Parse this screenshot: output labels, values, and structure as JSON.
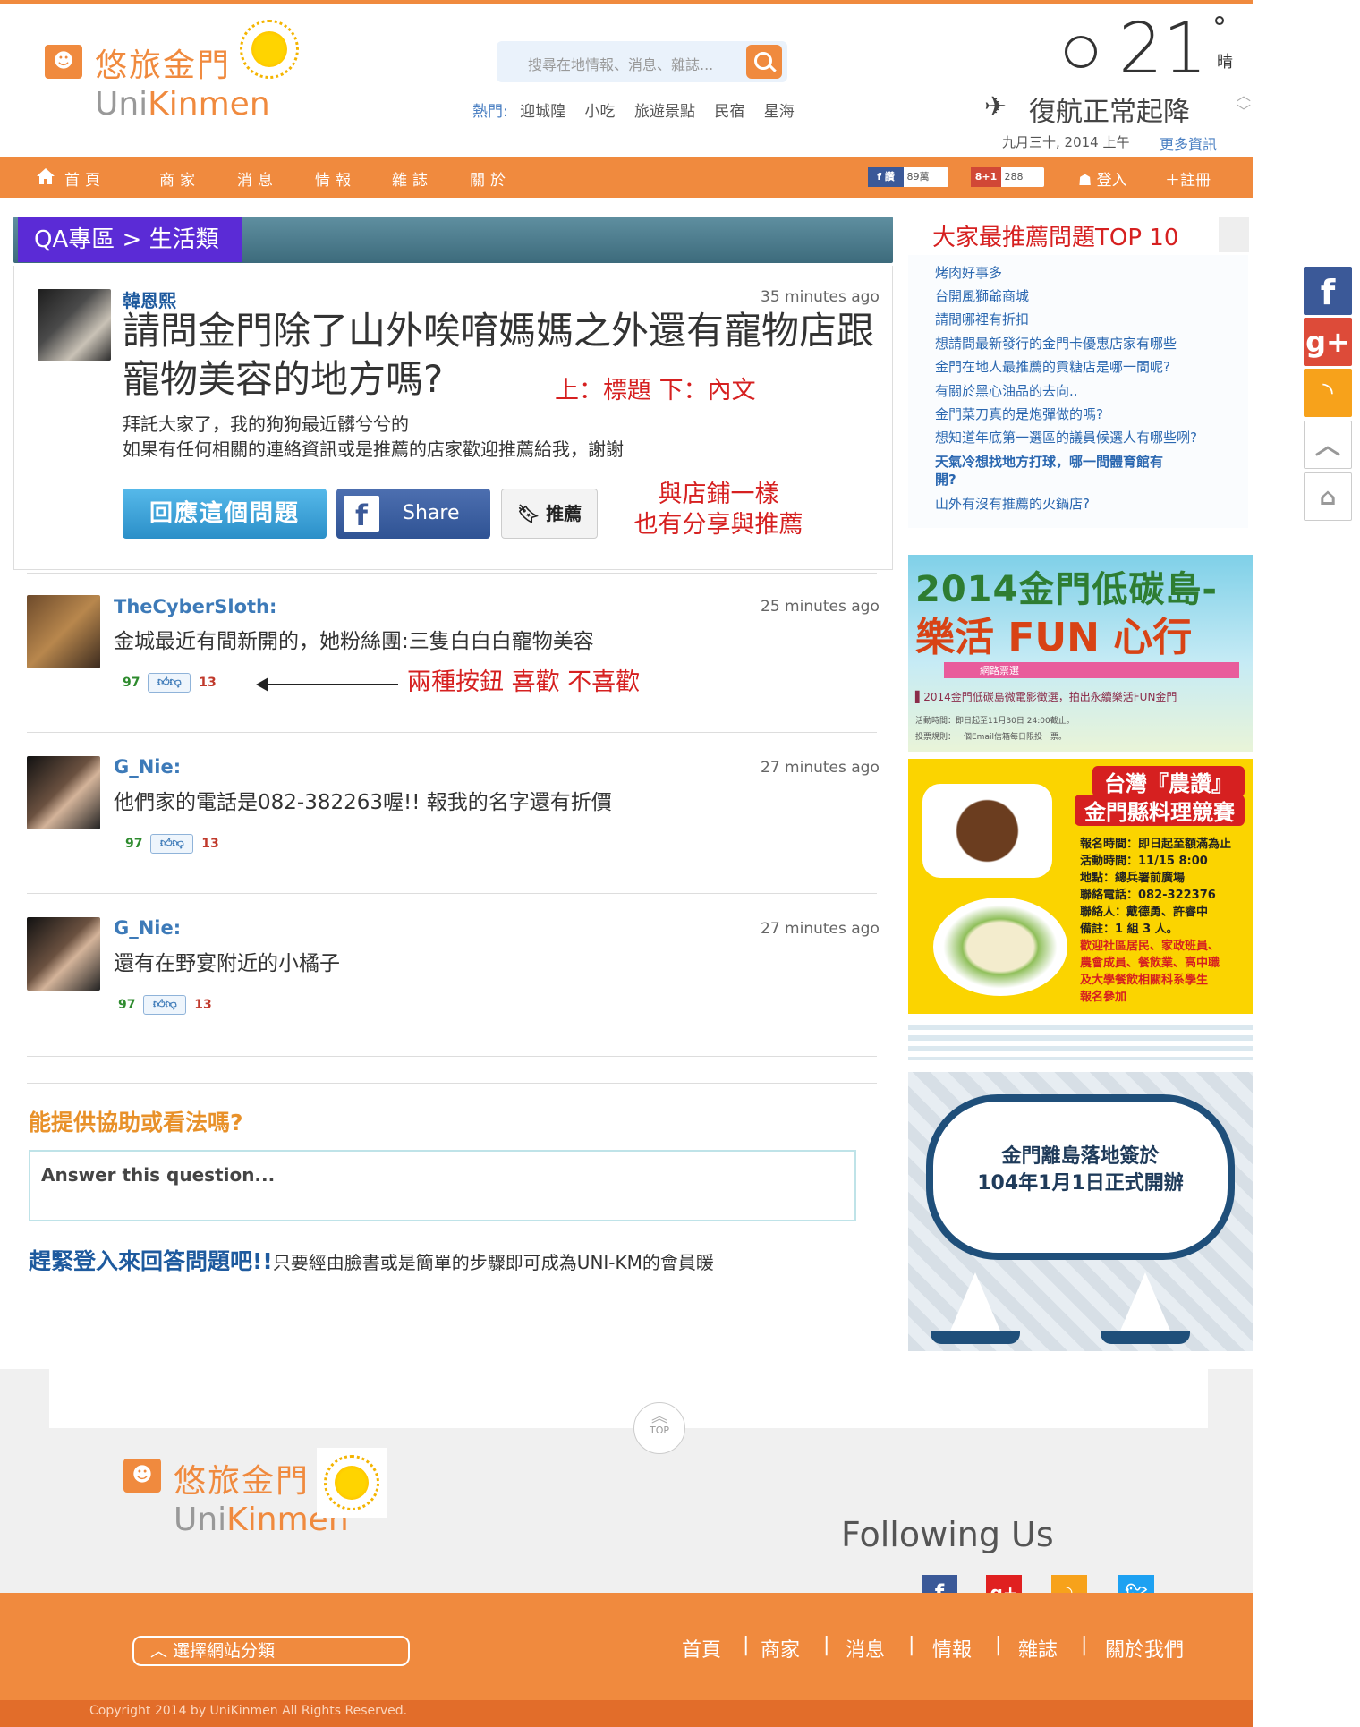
{
  "header": {
    "logo_cn": "悠旅金門",
    "logo_en_prefix": "Uni",
    "logo_en_suffix": "Kinmen",
    "search_placeholder": "搜尋在地情報、消息、雜誌...",
    "hot_label": "熱門:",
    "hot_tags": [
      "迎城隍",
      "小吃",
      "旅遊景點",
      "民宿",
      "星海"
    ]
  },
  "weather": {
    "temperature": "21",
    "degree": "°",
    "condition": "晴",
    "flight_status": "復航正常起降",
    "date": "九月三十, 2014  上午",
    "more_link": "更多資訊"
  },
  "nav": {
    "items": [
      "首頁",
      "商家",
      "消息",
      "情報",
      "雜誌",
      "關於"
    ],
    "fb_count": "89萬",
    "gplus_label": "8+1",
    "gplus_count": "288",
    "login": "登入",
    "register": "註冊"
  },
  "breadcrumb": "QA專區 > 生活類",
  "question": {
    "user": "韓恩熙",
    "time": "35 minutes ago",
    "title": "請問金門除了山外唉唷媽媽之外還有寵物店跟寵物美容的地方嗎?",
    "body_line1": "拜託大家了，我的狗狗最近髒兮兮的",
    "body_line2": "如果有任何相關的連絡資訊或是推薦的店家歡迎推薦給我，謝謝",
    "reply_button": "回應這個問題",
    "share_button": "Share",
    "recommend_button": "推薦"
  },
  "annotations": {
    "title_note": "上：標題 下：內文",
    "share_note_1": "與店鋪一樣",
    "share_note_2": "也有分享與推薦",
    "vote_note": "兩種按鈕 喜歡 不喜歡"
  },
  "answers": [
    {
      "user": "TheCyberSloth:",
      "time": "25 minutes ago",
      "text": "金城最近有間新開的，她粉絲團:三隻白白白寵物美容",
      "likes": "97",
      "dislikes": "13"
    },
    {
      "user": "G_Nie:",
      "time": "27 minutes ago",
      "text": "他們家的電話是082-382263喔!! 報我的名字還有折價",
      "likes": "97",
      "dislikes": "13"
    },
    {
      "user": "G_Nie:",
      "time": "27 minutes ago",
      "text": "還有在野宴附近的小橘子",
      "likes": "97",
      "dislikes": "13"
    }
  ],
  "help": {
    "title": "能提供協助或看法嗎?",
    "answer_placeholder": "Answer this question...",
    "cta_bold": "趕緊登入來回答問題吧!!",
    "cta_text": "只要經由臉書或是簡單的步驟即可成為UNI-KM的會員䁔"
  },
  "sidebar": {
    "title": "大家最推薦問題TOP 10",
    "items": [
      "烤肉好事多",
      "台開風獅爺商城",
      "請問哪裡有折扣",
      "想請問最新發行的金門卡優惠店家有哪些",
      "金門在地人最推薦的貢糖店是哪一間呢?",
      "有關於黑心油品的去向..",
      "金門菜刀真的是炮彈做的嗎?",
      "想知道年底第一選區的議員候選人有哪些咧?",
      "天氣冷想找地方打球，哪一間體育館有",
      "開?",
      "山外有沒有推薦的火鍋店?"
    ]
  },
  "ads": {
    "ad1_title1": "2014金門低碳島-",
    "ad1_title2": "樂活 FUN 心行",
    "ad1_bar": "網路票選",
    "ad1_line1": "▌2014金門低碳島微電影徵選，拍出永續樂活FUN金門",
    "ad1_line2": "活動時間：即日起至11月30日 24:00截止。",
    "ad1_line3": "投票規則：一個Email信箱每日限投一票。",
    "ad2_title1": "台灣『農讚』",
    "ad2_title2": "金門縣料理競賽",
    "ad2_info": [
      "報名時間：即日起至額滿為止",
      "活動時間：11/15  8:00",
      "地點：總兵署前廣場",
      "聯絡電話：082-322376",
      "聯絡人：戴德勇、許睿中",
      "備註：1 組 3 人。"
    ],
    "ad2_red": [
      "歡迎社區居民、家政班員、",
      "農會成員、餐飲業、高中職",
      "及大學餐飲相關科系學生",
      "報名參加"
    ],
    "ad3_line1": "金門離島落地簽於",
    "ad3_line2": "104年1月1日正式開辦"
  },
  "footer": {
    "top_label": "TOP",
    "logo_cn": "悠旅金門",
    "logo_en_prefix": "Uni",
    "logo_en_suffix": "Kinmen",
    "following": "Following Us",
    "site_select": "選擇網站分類",
    "nav": [
      "首頁",
      "商家",
      "消息",
      "情報",
      "雜誌",
      "關於我們"
    ],
    "copyright": "Copyright 2014 by UniKinmen All Rights Reserved."
  },
  "colors": {
    "brand_orange": "#f08a3e",
    "link_blue": "#2a67b0",
    "annotation_red": "#d62020",
    "crumb_purple": "#5b2bd6"
  }
}
